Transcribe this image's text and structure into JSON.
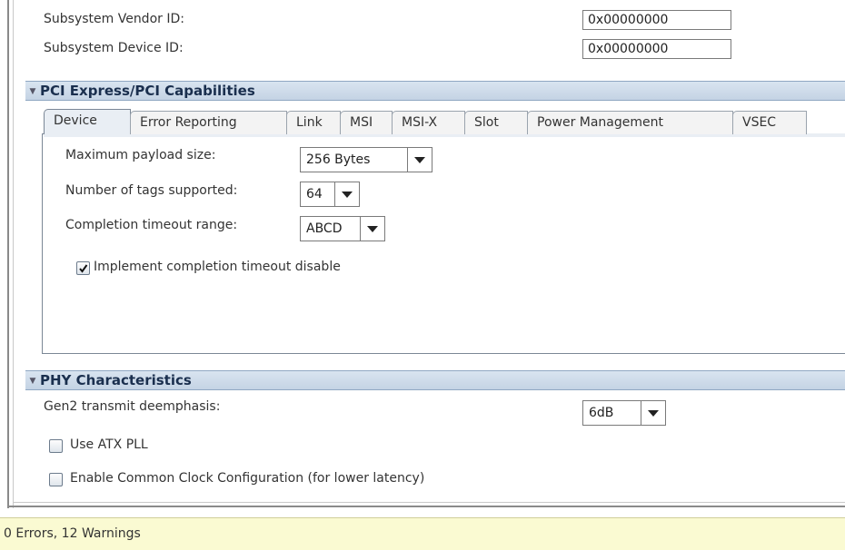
{
  "identity": {
    "subsystem_vendor_id_label": "Subsystem Vendor ID:",
    "subsystem_vendor_id_value": "0x00000000",
    "subsystem_device_id_label": "Subsystem Device ID:",
    "subsystem_device_id_value": "0x00000000"
  },
  "pcie_section": {
    "title": "PCI Express/PCI Capabilities",
    "tabs": [
      {
        "label": "Device"
      },
      {
        "label": "Error Reporting"
      },
      {
        "label": "Link"
      },
      {
        "label": "MSI"
      },
      {
        "label": "MSI-X"
      },
      {
        "label": "Slot"
      },
      {
        "label": "Power Management"
      },
      {
        "label": "VSEC"
      }
    ],
    "active_tab": "Device",
    "device": {
      "max_payload_label": "Maximum payload size:",
      "max_payload_value": "256 Bytes",
      "num_tags_label": "Number of tags supported:",
      "num_tags_value": "64",
      "completion_timeout_label": "Completion timeout range:",
      "completion_timeout_value": "ABCD",
      "completion_disable_label": "Implement completion timeout disable",
      "completion_disable_checked": true
    }
  },
  "phy_section": {
    "title": "PHY Characteristics",
    "gen2_deemphasis_label": "Gen2 transmit deemphasis:",
    "gen2_deemphasis_value": "6dB",
    "use_atx_pll_label": "Use ATX PLL",
    "use_atx_pll_checked": false,
    "common_clock_label": "Enable Common Clock Configuration (for lower latency)",
    "common_clock_checked": false
  },
  "status": {
    "text": "0 Errors, 12 Warnings"
  },
  "colors": {
    "section_header_bg": "#c4d3e4",
    "section_header_text": "#1a2f4e",
    "status_bar_bg": "#fafad2",
    "tab_active_bg": "#e9eef4"
  },
  "icons": {
    "collapse": "triangle-down-icon",
    "dropdown": "chevron-down-icon",
    "check": "checkmark-icon"
  }
}
